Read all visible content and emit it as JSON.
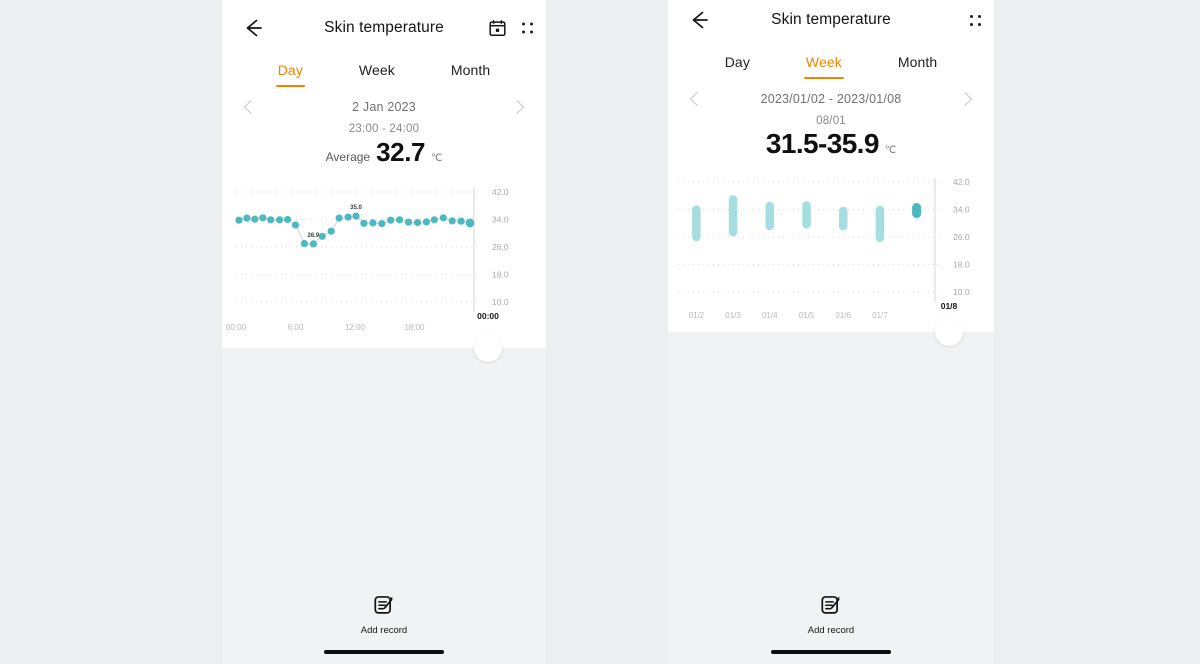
{
  "theme": {
    "accent": "#f08300",
    "dot_teal": "#4cb8bf",
    "bar_teal_light": "#a5dde0",
    "bar_teal_active": "#4cb8bf",
    "page_bg": "#eceef0",
    "card_bg": "#ffffff",
    "panel_bg": "#f1f2f4"
  },
  "day_view": {
    "header": {
      "title": "Skin temperature",
      "back_icon": "back-arrow-icon",
      "calendar_icon": "calendar-icon",
      "more_icon": "more-options-icon"
    },
    "tabs": [
      {
        "label": "Day",
        "active": true
      },
      {
        "label": "Week",
        "active": false
      },
      {
        "label": "Month",
        "active": false
      }
    ],
    "date": "2 Jan 2023",
    "prev_icon": "chevron-left-icon",
    "next_icon": "chevron-right-icon",
    "time_range": "23:00 - 24:00",
    "average_label": "Average",
    "average_value": "32.7",
    "unit": "℃",
    "footer": {
      "add_record_label": "Add record",
      "add_record_icon": "note-edit-icon"
    }
  },
  "week_view": {
    "header": {
      "title": "Skin temperature",
      "back_icon": "back-arrow-icon",
      "more_icon": "more-options-icon"
    },
    "tabs": [
      {
        "label": "Day",
        "active": false
      },
      {
        "label": "Week",
        "active": true
      },
      {
        "label": "Month",
        "active": false
      }
    ],
    "date": "2023/01/02 - 2023/01/08",
    "prev_icon": "chevron-left-icon",
    "next_icon": "chevron-right-icon",
    "selected_day": "08/01",
    "range_value": "31.5-35.9",
    "unit": "℃",
    "footer": {
      "add_record_label": "Add record",
      "add_record_icon": "note-edit-icon"
    }
  },
  "chart_data": [
    {
      "id": "day_chart",
      "type": "scatter",
      "title": "Skin temperature — 2 Jan 2023",
      "xlabel": "",
      "ylabel": "℃",
      "ylim": [
        10.0,
        42.0
      ],
      "yticks": [
        42.0,
        34.0,
        26.0,
        18.0,
        10.0
      ],
      "ytick_labels": [
        "42.0",
        "34.0",
        "26.0",
        "18.0",
        "10.0"
      ],
      "xticks": [
        0,
        6,
        12,
        18
      ],
      "xtick_labels": [
        "00:00",
        "6:00",
        "12:00",
        "18:00"
      ],
      "cursor_label": "00:00",
      "grid": true,
      "legend": "none",
      "point_labels": {
        "max": "35.0",
        "min": "26.9"
      },
      "x": [
        0.3,
        1.1,
        1.9,
        2.7,
        3.5,
        4.4,
        5.2,
        6.0,
        6.9,
        7.8,
        8.7,
        9.6,
        10.4,
        11.3,
        12.1,
        12.9,
        13.8,
        14.7,
        15.6,
        16.5,
        17.4,
        18.3,
        19.2,
        20.0,
        20.9,
        21.8,
        22.7,
        23.6
      ],
      "values": [
        33.8,
        34.4,
        34.1,
        34.5,
        33.9,
        33.9,
        34.0,
        32.4,
        27.0,
        26.9,
        29.1,
        30.6,
        34.4,
        34.7,
        35.0,
        32.9,
        33.0,
        32.8,
        33.8,
        33.9,
        33.2,
        33.1,
        33.3,
        33.9,
        34.5,
        33.6,
        33.5,
        33.0
      ]
    },
    {
      "id": "week_chart",
      "type": "bar",
      "subtype": "range-bar",
      "title": "Skin temperature — 2023/01/02 - 2023/01/08",
      "xlabel": "",
      "ylabel": "℃",
      "ylim": [
        10.0,
        42.0
      ],
      "yticks": [
        42.0,
        34.0,
        26.0,
        18.0,
        10.0
      ],
      "ytick_labels": [
        "42.0",
        "34.0",
        "26.0",
        "18.0",
        "10.0"
      ],
      "categories": [
        "01/2",
        "01/3",
        "01/4",
        "01/5",
        "01/6",
        "01/7",
        "01/8"
      ],
      "grid": true,
      "legend": "none",
      "selected_index": 6,
      "series": [
        {
          "name": "min",
          "values": [
            24.8,
            26.2,
            28.0,
            28.4,
            27.9,
            24.5,
            31.5
          ]
        },
        {
          "name": "max",
          "values": [
            35.2,
            38.2,
            36.2,
            36.4,
            34.8,
            35.1,
            35.9
          ]
        }
      ]
    }
  ]
}
